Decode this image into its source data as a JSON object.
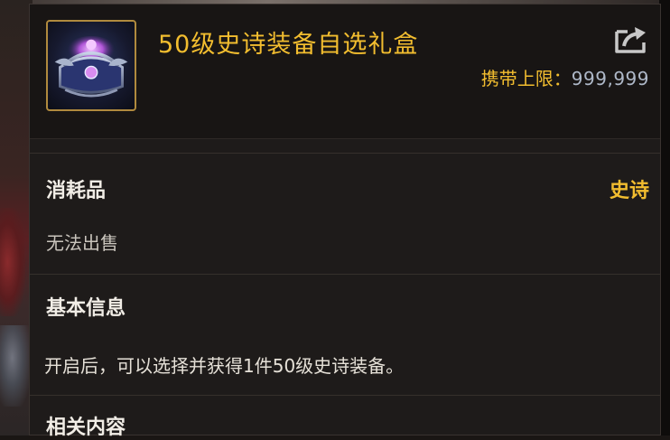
{
  "item": {
    "title": "50级史诗装备自选礼盒",
    "icon": "epic-equipment-chest-icon",
    "carry_limit_label": "携带上限：",
    "carry_limit_value": "999,999",
    "share_icon": "share-icon"
  },
  "properties": {
    "category": "消耗品",
    "rarity": "史诗",
    "trade_status": "无法出售"
  },
  "sections": {
    "basic_info_title": "基本信息",
    "basic_info_text": "开启后，可以选择并获得1件50级史诗装备。",
    "related_title": "相关内容"
  },
  "colors": {
    "title_gold": "#f2bd2f",
    "limit_value": "#aeb8c8",
    "panel_bg": "#1e1b1a",
    "icon_border": "#b08a3e"
  }
}
